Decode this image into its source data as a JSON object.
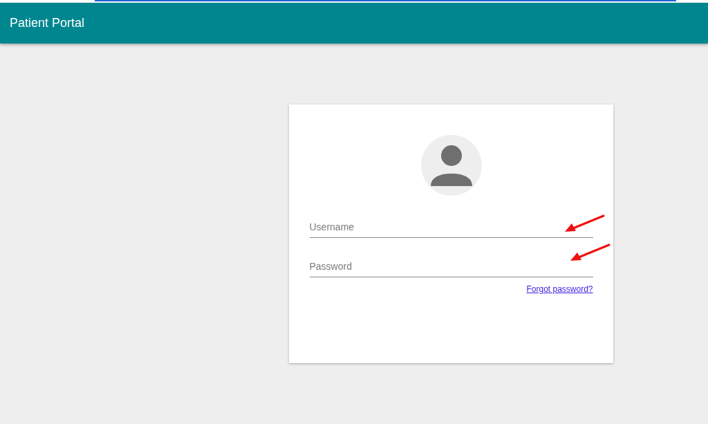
{
  "app_bar": {
    "title": "Patient Portal"
  },
  "login": {
    "fields": [
      {
        "placeholder": "Username"
      },
      {
        "placeholder": "Password"
      }
    ],
    "forgot_link": "Forgot password?"
  }
}
